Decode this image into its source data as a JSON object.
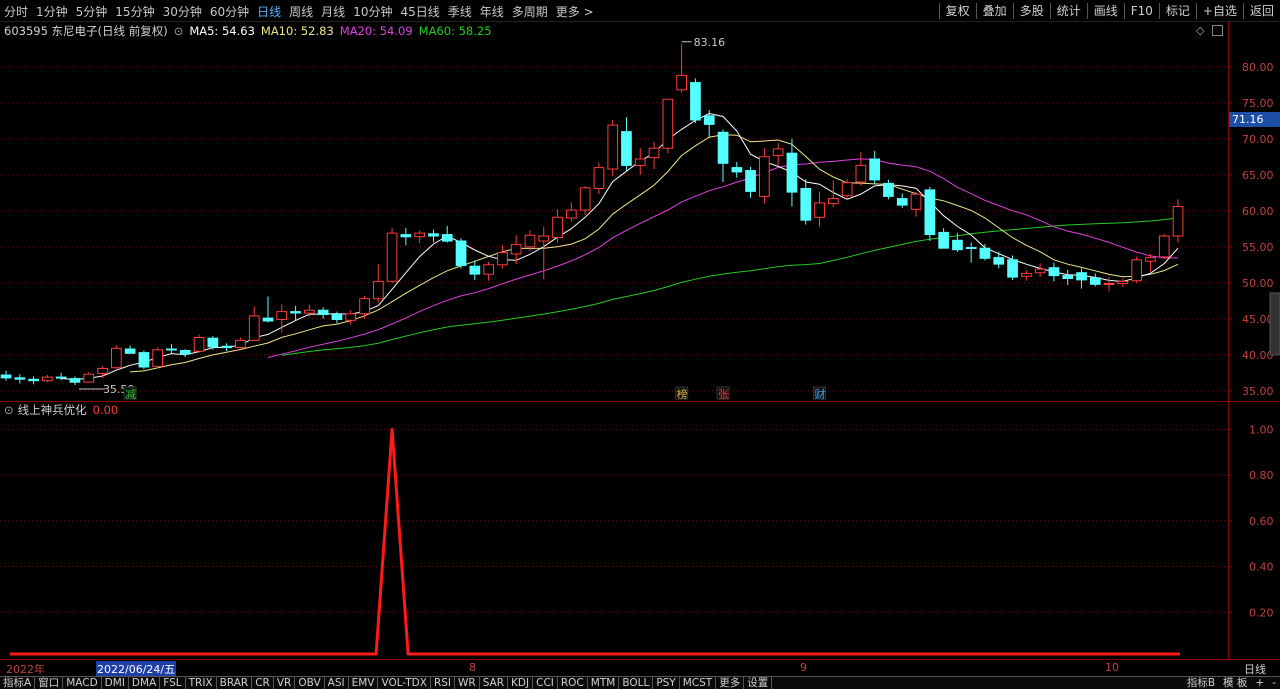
{
  "toolbar": {
    "periods": [
      {
        "label": "分时"
      },
      {
        "label": "1分钟"
      },
      {
        "label": "5分钟"
      },
      {
        "label": "15分钟"
      },
      {
        "label": "30分钟"
      },
      {
        "label": "60分钟"
      },
      {
        "label": "日线",
        "active": true
      },
      {
        "label": "周线"
      },
      {
        "label": "月线"
      },
      {
        "label": "10分钟"
      },
      {
        "label": "45日线"
      },
      {
        "label": "季线"
      },
      {
        "label": "年线"
      },
      {
        "label": "多周期"
      },
      {
        "label": "更多 >"
      }
    ],
    "right_buttons": [
      "复权",
      "叠加",
      "多股",
      "统计",
      "画线",
      "F10",
      "标记",
      "+自选",
      "返回"
    ]
  },
  "stock": {
    "code_name": "603595 东尼电子(日线 前复权)",
    "ma5": "MA5: 54.63",
    "ma10": "MA10: 52.83",
    "ma20": "MA20: 54.09",
    "ma60": "MA60: 58.25"
  },
  "indicator": {
    "name": "线上神兵优化",
    "value": "0.00"
  },
  "price_tag": "71.16",
  "high_label": "83.16",
  "low_label": "35.58",
  "markers": [
    {
      "text": "减",
      "color": "#2fbf2f"
    },
    {
      "text": "榜",
      "color": "#d8b040"
    },
    {
      "text": "张",
      "color": "#ff3030"
    },
    {
      "text": "财",
      "color": "#40a0ff"
    }
  ],
  "dates": {
    "year": "2022年",
    "selected": "2022/06/24/五",
    "m8": "8",
    "m9": "9",
    "m10": "10",
    "period": "日线"
  },
  "tabs": [
    "指标A",
    "窗口",
    "MACD",
    "DMI",
    "DMA",
    "FSL",
    "TRIX",
    "BRAR",
    "CR",
    "VR",
    "OBV",
    "ASI",
    "EMV",
    "VOL-TDX",
    "RSI",
    "WR",
    "SAR",
    "KDJ",
    "CCI",
    "ROC",
    "MTM",
    "BOLL",
    "PSY",
    "MCST",
    "更多",
    "设置"
  ],
  "tabs_right": [
    "指标B",
    "模 板",
    "+",
    "-"
  ],
  "colors": {
    "up": "#ff3b3b",
    "down": "#54ffff",
    "ma5": "#ffffff",
    "ma10": "#f0e68c",
    "ma20": "#e040e0",
    "ma60": "#22cc22",
    "signal": "#ff1a1a"
  },
  "chart_data": {
    "type": "candlestick",
    "y_axis_ticks": [
      35,
      40,
      45,
      50,
      55,
      60,
      65,
      70,
      75,
      80
    ],
    "ylim": [
      34,
      84
    ],
    "indicator_ticks": [
      "1.00",
      "0.80",
      "0.60",
      "0.40",
      "0.20"
    ],
    "indicator_ylim": [
      0,
      1.05
    ],
    "candles": [
      [
        37.2,
        37.8,
        36.4,
        36.8
      ],
      [
        36.8,
        37.3,
        36.0,
        36.6
      ],
      [
        36.6,
        37.0,
        35.9,
        36.4
      ],
      [
        36.4,
        37.2,
        36.2,
        36.9
      ],
      [
        36.9,
        37.5,
        36.5,
        36.8
      ],
      [
        36.7,
        37.0,
        35.8,
        36.2
      ],
      [
        36.2,
        37.6,
        36.1,
        37.3
      ],
      [
        37.4,
        38.4,
        36.8,
        38.1
      ],
      [
        38.2,
        41.3,
        38.0,
        40.9
      ],
      [
        40.8,
        41.3,
        40.1,
        40.2
      ],
      [
        40.3,
        40.6,
        38.0,
        38.3
      ],
      [
        38.4,
        41.0,
        38.1,
        40.7
      ],
      [
        40.8,
        41.5,
        40.2,
        40.7
      ],
      [
        40.6,
        40.8,
        39.7,
        40.1
      ],
      [
        40.5,
        42.8,
        40.3,
        42.4
      ],
      [
        42.3,
        42.6,
        40.7,
        41.1
      ],
      [
        41.2,
        41.6,
        40.5,
        41.0
      ],
      [
        41.0,
        42.4,
        40.9,
        42.0
      ],
      [
        42.0,
        46.7,
        41.9,
        45.4
      ],
      [
        45.1,
        48.1,
        44.5,
        44.7
      ],
      [
        44.9,
        47.0,
        43.1,
        46.0
      ],
      [
        46.0,
        46.8,
        44.8,
        45.8
      ],
      [
        45.8,
        47.0,
        45.3,
        46.2
      ],
      [
        46.2,
        46.6,
        45.0,
        45.6
      ],
      [
        45.6,
        46.0,
        44.4,
        44.9
      ],
      [
        44.8,
        46.2,
        44.2,
        45.7
      ],
      [
        45.7,
        48.2,
        45.0,
        47.8
      ],
      [
        47.8,
        52.6,
        47.3,
        50.2
      ],
      [
        50.2,
        57.6,
        50.0,
        56.9
      ],
      [
        56.7,
        57.6,
        55.2,
        56.4
      ],
      [
        56.4,
        57.3,
        55.5,
        56.9
      ],
      [
        56.8,
        57.4,
        55.6,
        56.5
      ],
      [
        56.7,
        57.9,
        55.6,
        55.8
      ],
      [
        55.8,
        56.2,
        52.0,
        52.4
      ],
      [
        52.3,
        53.1,
        50.4,
        51.2
      ],
      [
        51.2,
        52.9,
        50.3,
        52.5
      ],
      [
        52.5,
        55.2,
        52.0,
        54.2
      ],
      [
        54.0,
        56.6,
        52.6,
        55.3
      ],
      [
        55.0,
        57.3,
        54.4,
        56.6
      ],
      [
        55.8,
        57.8,
        50.5,
        56.5
      ],
      [
        56.3,
        60.2,
        55.6,
        59.1
      ],
      [
        59.0,
        61.2,
        58.5,
        60.1
      ],
      [
        60.1,
        63.4,
        59.4,
        63.2
      ],
      [
        63.1,
        66.7,
        62.3,
        66.0
      ],
      [
        65.8,
        72.6,
        64.8,
        71.9
      ],
      [
        71.0,
        73.0,
        65.6,
        66.3
      ],
      [
        66.3,
        68.7,
        65.0,
        67.2
      ],
      [
        67.4,
        69.6,
        65.8,
        68.7
      ],
      [
        68.7,
        75.2,
        68.0,
        75.5
      ],
      [
        76.8,
        83.2,
        76.4,
        78.8
      ],
      [
        77.8,
        78.4,
        72.2,
        72.6
      ],
      [
        73.2,
        74.0,
        70.1,
        72.0
      ],
      [
        70.9,
        71.3,
        64.0,
        66.6
      ],
      [
        66.0,
        66.8,
        64.6,
        65.4
      ],
      [
        65.6,
        66.1,
        61.8,
        62.7
      ],
      [
        62.0,
        68.7,
        61.0,
        67.5
      ],
      [
        67.7,
        69.4,
        66.3,
        68.6
      ],
      [
        68.0,
        70.0,
        60.6,
        62.6
      ],
      [
        63.1,
        64.4,
        58.1,
        58.7
      ],
      [
        59.1,
        62.7,
        57.8,
        61.1
      ],
      [
        61.0,
        64.2,
        60.5,
        61.7
      ],
      [
        62.1,
        64.4,
        61.6,
        63.9
      ],
      [
        64.0,
        68.2,
        63.5,
        66.3
      ],
      [
        67.2,
        68.3,
        63.8,
        64.3
      ],
      [
        63.8,
        64.3,
        61.6,
        62.0
      ],
      [
        61.7,
        62.4,
        60.4,
        60.8
      ],
      [
        60.2,
        62.6,
        59.2,
        62.3
      ],
      [
        62.9,
        63.3,
        55.8,
        56.7
      ],
      [
        57.0,
        57.6,
        54.8,
        54.8
      ],
      [
        55.9,
        56.9,
        54.3,
        54.6
      ],
      [
        54.9,
        55.6,
        52.8,
        54.8
      ],
      [
        54.8,
        55.4,
        53.1,
        53.4
      ],
      [
        53.5,
        54.3,
        52.0,
        52.6
      ],
      [
        53.2,
        53.8,
        50.4,
        50.8
      ],
      [
        50.9,
        51.7,
        50.3,
        51.3
      ],
      [
        51.4,
        52.7,
        50.8,
        51.9
      ],
      [
        52.1,
        52.8,
        50.2,
        51.0
      ],
      [
        51.0,
        51.8,
        49.7,
        50.6
      ],
      [
        51.4,
        52.0,
        49.2,
        50.4
      ],
      [
        50.7,
        51.3,
        49.5,
        49.8
      ],
      [
        49.9,
        50.8,
        48.8,
        49.9
      ],
      [
        49.9,
        50.6,
        49.4,
        50.2
      ],
      [
        50.3,
        53.6,
        50.0,
        53.2
      ],
      [
        53.0,
        54.0,
        51.5,
        53.5
      ],
      [
        53.6,
        56.8,
        53.3,
        56.5
      ],
      [
        56.5,
        61.6,
        55.6,
        60.6
      ]
    ],
    "indicator_spike": {
      "index": 28,
      "value": 1.0
    }
  }
}
